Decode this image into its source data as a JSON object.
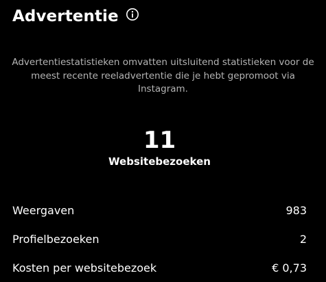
{
  "header": {
    "title": "Advertentie",
    "info_icon": "info-circle-icon"
  },
  "description": "Advertentiestatistieken omvatten uitsluitend statistieken voor de meest recente reeladvertentie die je hebt gepromoot via Instagram.",
  "highlight": {
    "value": "11",
    "label": "Websitebezoeken"
  },
  "stats": [
    {
      "label": "Weergaven",
      "value": "983"
    },
    {
      "label": "Profielbezoeken",
      "value": "2"
    },
    {
      "label": "Kosten per websitebezoek",
      "value": "€ 0,73"
    }
  ],
  "colors": {
    "background": "#000000",
    "text": "#ffffff",
    "muted_text": "#b5b5b5"
  }
}
